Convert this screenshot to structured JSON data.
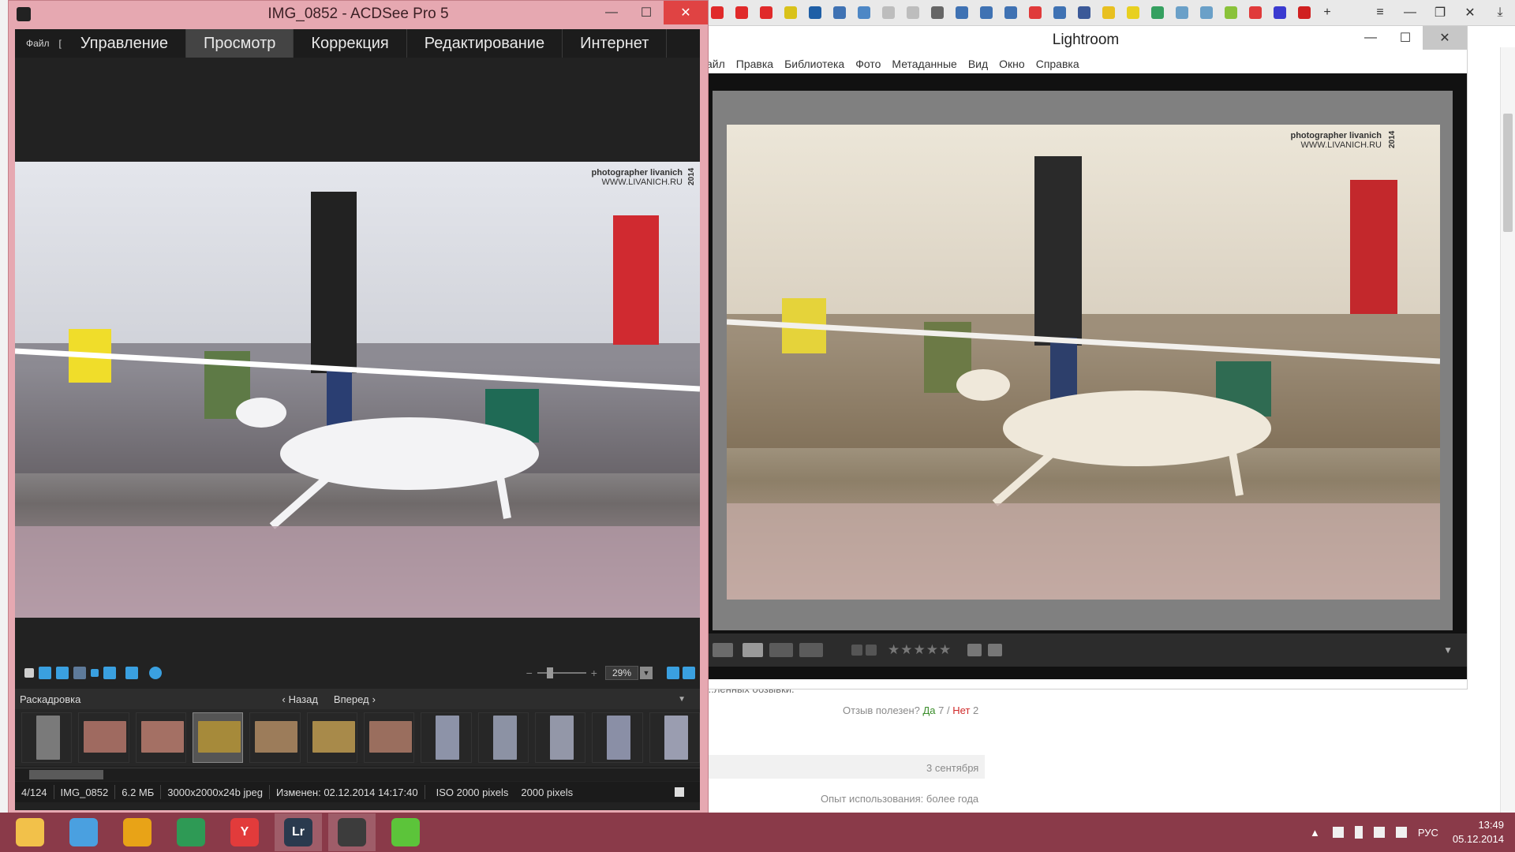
{
  "browser": {
    "tab_icons": [
      {
        "name": "youtube-icon",
        "color": "#e02a2a"
      },
      {
        "name": "youtube-icon",
        "color": "#e02a2a"
      },
      {
        "name": "youtube-icon",
        "color": "#e02a2a"
      },
      {
        "name": "play-icon",
        "color": "#d9c21a"
      },
      {
        "name": "nj-icon",
        "color": "#1f5fa6"
      },
      {
        "name": "page-icon",
        "color": "#3f72b3"
      },
      {
        "name": "text-icon",
        "color": "#4d87c5"
      },
      {
        "name": "page-icon",
        "color": "#bdbdbd"
      },
      {
        "name": "page-icon",
        "color": "#bdbdbd"
      },
      {
        "name": "camera-icon",
        "color": "#666666"
      },
      {
        "name": "page-icon",
        "color": "#3f72b3"
      },
      {
        "name": "page-icon",
        "color": "#3f72b3"
      },
      {
        "name": "page-icon",
        "color": "#3f72b3"
      },
      {
        "name": "yandex-icon",
        "color": "#e03a3a"
      },
      {
        "name": "page-icon",
        "color": "#3f72b3"
      },
      {
        "name": "facebook-icon",
        "color": "#3b5998"
      },
      {
        "name": "image-icon",
        "color": "#e8c020"
      },
      {
        "name": "pencil-icon",
        "color": "#e8d020"
      },
      {
        "name": "globe-icon",
        "color": "#35a060"
      },
      {
        "name": "users-icon",
        "color": "#6aa0c8"
      },
      {
        "name": "users-icon",
        "color": "#6aa0c8"
      },
      {
        "name": "smile-icon",
        "color": "#8ac23a"
      },
      {
        "name": "yandex-icon",
        "color": "#e03a3a"
      },
      {
        "name": "flag-icon",
        "color": "#3a3ad0"
      },
      {
        "name": "t-icon",
        "color": "#d02020"
      }
    ],
    "new_tab": "+",
    "menu_icon": "≡",
    "minimize": "—",
    "maximize": "❐",
    "close": "✕",
    "download": "⤓",
    "review_cutoff": "...ленных обзывки.",
    "helpful_prefix": "Отзыв полезен?",
    "helpful_yes": "Да",
    "helpful_yes_count": "7",
    "helpful_sep": "/",
    "helpful_no": "Нет",
    "helpful_no_count": "2",
    "review_date": "3 сентября",
    "experience": "Опыт использования: более года"
  },
  "lightroom": {
    "title": "Lightroom",
    "minimize": "—",
    "maximize": "☐",
    "close": "✕",
    "menu": [
      "айл",
      "Правка",
      "Библиотека",
      "Фото",
      "Метаданные",
      "Вид",
      "Окно",
      "Справка"
    ],
    "watermark_line1": "photographer  livanich",
    "watermark_line2": "WWW.LIVANICH.RU",
    "watermark_year": "2014",
    "stars": "★★★★★"
  },
  "acdsee": {
    "title": "IMG_0852 - ACDSee Pro 5",
    "minimize": "—",
    "maximize": "☐",
    "close": "✕",
    "file_menu": "Файл",
    "file_menu_cut": "[",
    "modes": [
      "Управление",
      "Просмотр",
      "Коррекция",
      "Редактирование",
      "Интернет"
    ],
    "active_mode": "Просмотр",
    "zoom": "29%",
    "watermark_line1": "photographer  livanich",
    "watermark_line2": "WWW.LIVANICH.RU",
    "watermark_year": "2014",
    "filmstrip_label": "Раскадровка",
    "back": "Назад",
    "forward": "Вперед",
    "status": {
      "position": "4/124",
      "filename": "IMG_0852",
      "size": "6.2 МБ",
      "dimensions": "3000x2000x24b jpeg",
      "modified": "Изменен: 02.12.2014 14:17:40",
      "iso": "ISO 2000 pixels",
      "pixels": "2000 pixels"
    }
  },
  "taskbar": {
    "apps": [
      {
        "name": "explorer-icon",
        "color": "#f2c14a",
        "label": ""
      },
      {
        "name": "speaker-app-icon",
        "color": "#4aa0e0",
        "label": ""
      },
      {
        "name": "chrome-icon",
        "color": "#e8a317",
        "label": ""
      },
      {
        "name": "download-master-icon",
        "color": "#2e9a55",
        "label": ""
      },
      {
        "name": "yandex-browser-icon",
        "color": "#e23b3b",
        "label": "Y"
      },
      {
        "name": "lightroom-icon",
        "color": "#2a3a4e",
        "label": "Lr"
      },
      {
        "name": "acdsee-icon",
        "color": "#3c3c3c",
        "label": ""
      },
      {
        "name": "icq-icon",
        "color": "#5cc43a",
        "label": ""
      }
    ],
    "language": "РУС",
    "time": "13:49",
    "date": "05.12.2014"
  }
}
